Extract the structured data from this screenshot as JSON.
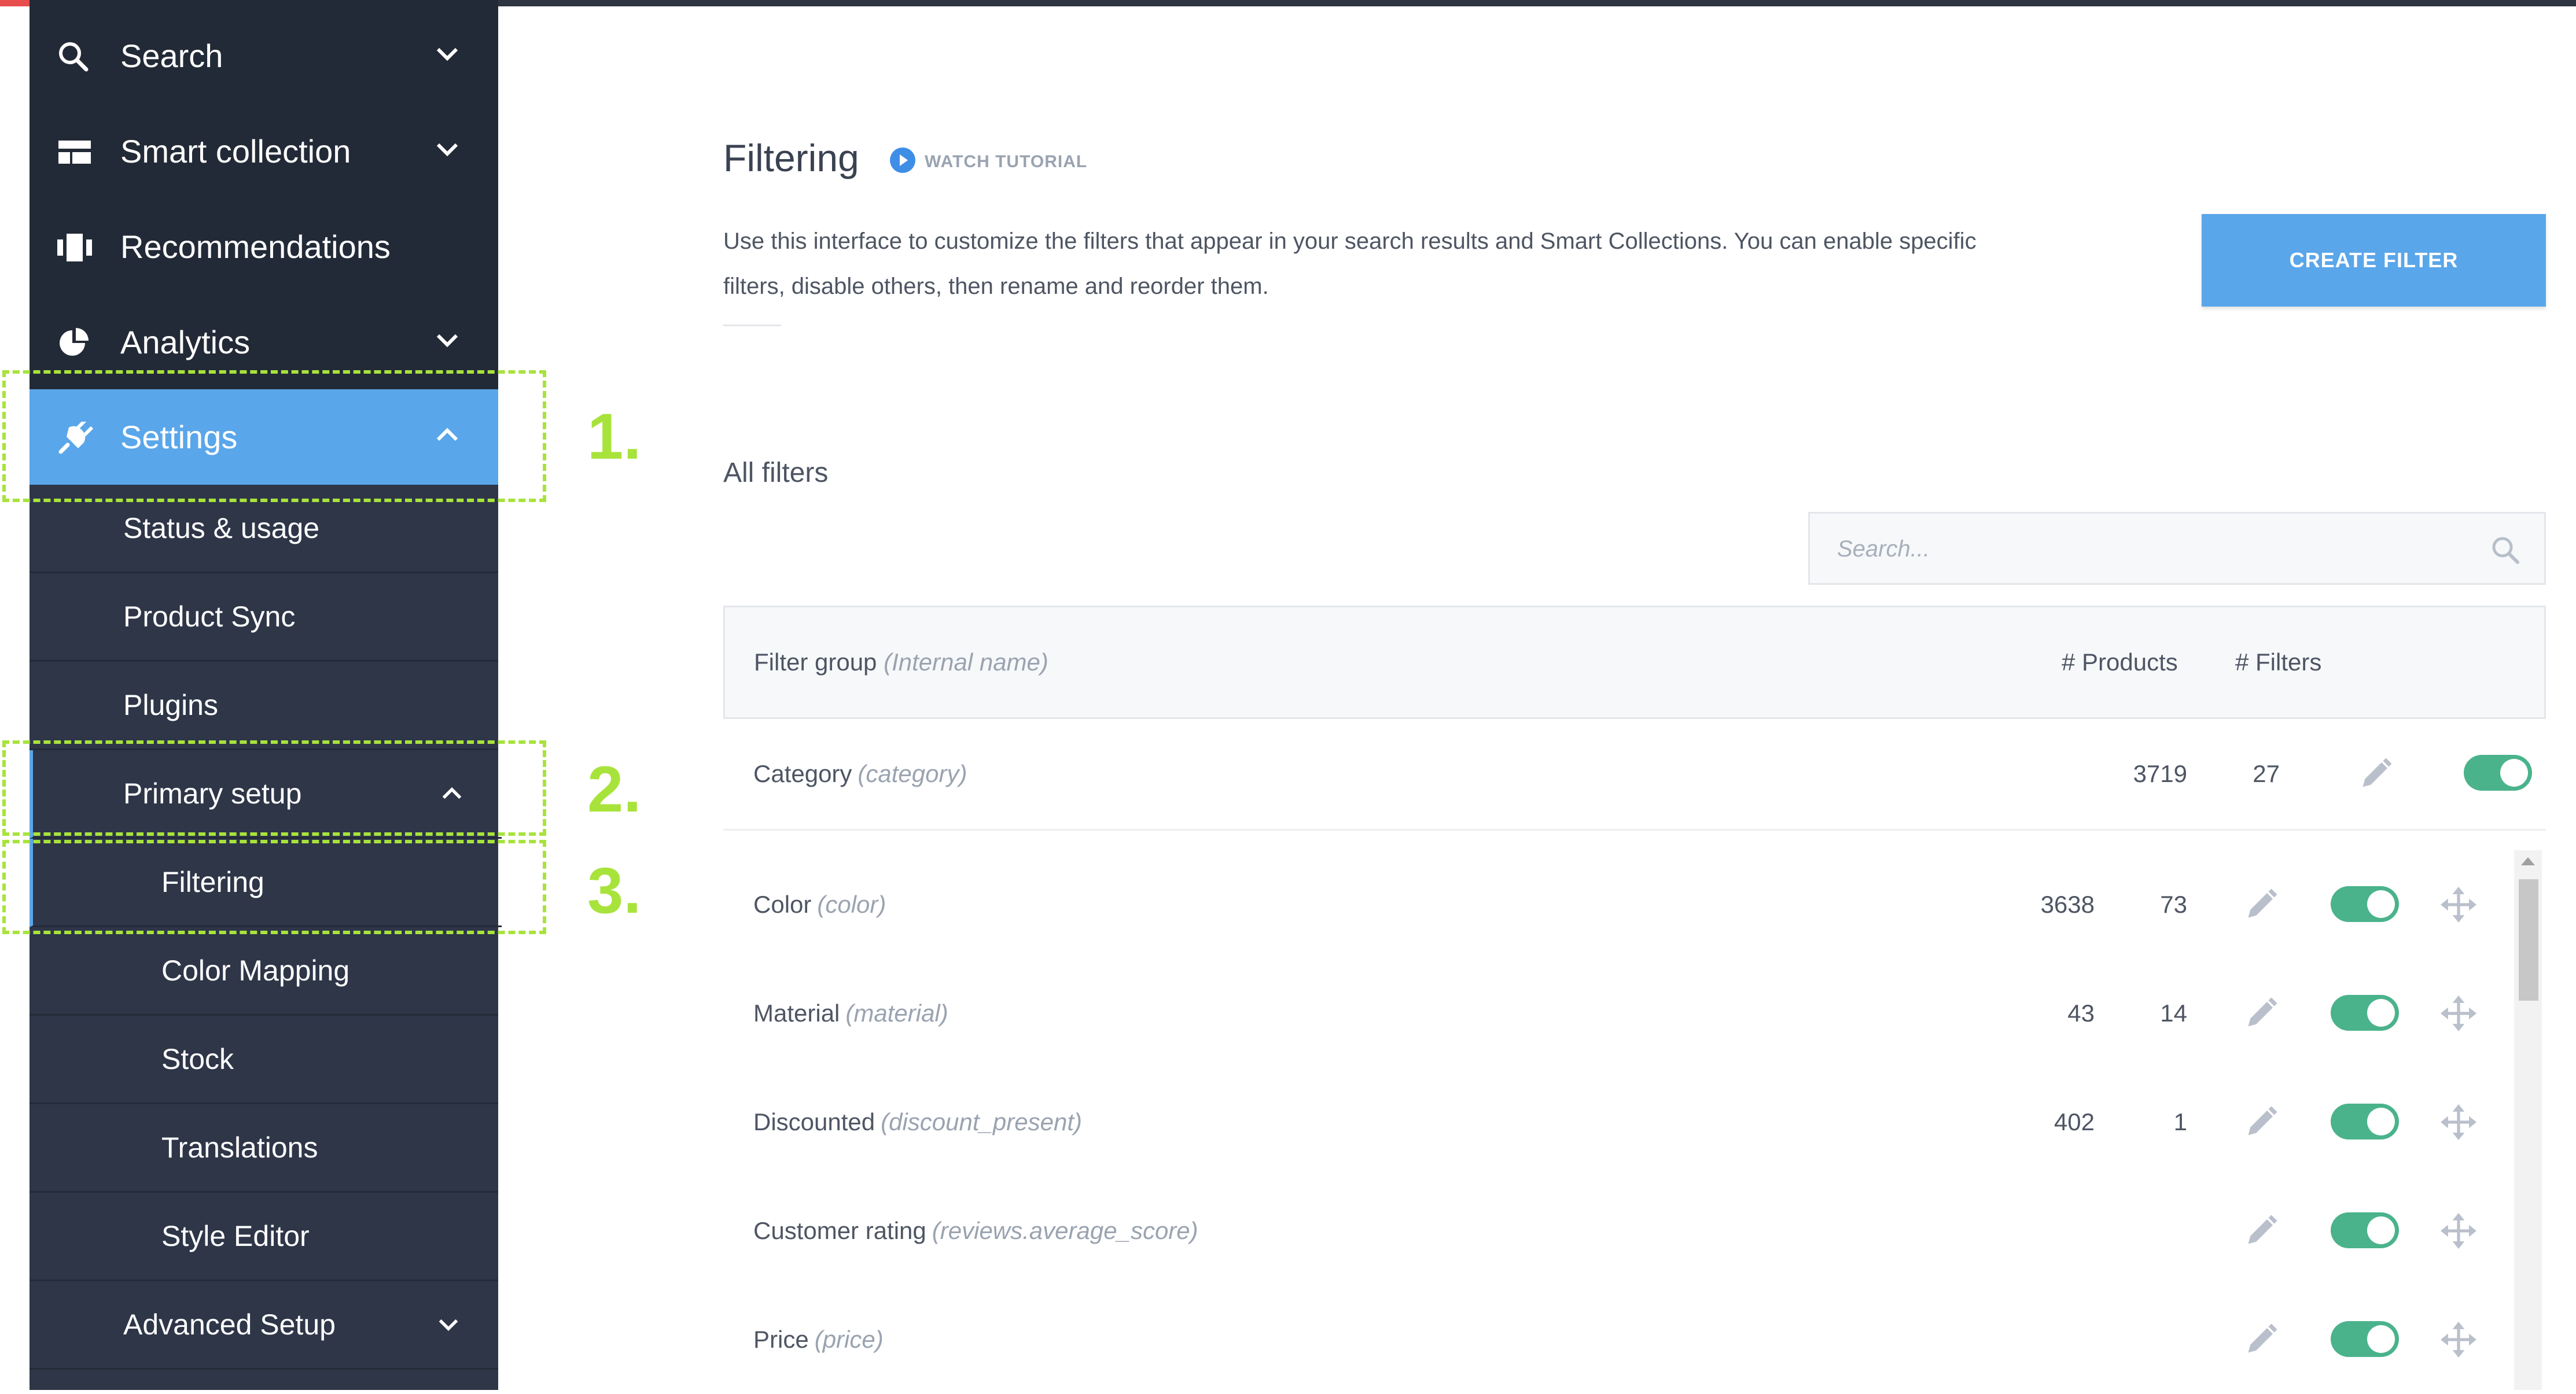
{
  "sidebar": {
    "top_items": [
      {
        "label": "Search",
        "icon": "search-icon",
        "chevron": "down"
      },
      {
        "label": "Smart collection",
        "icon": "collection-icon",
        "chevron": "down"
      },
      {
        "label": "Recommendations",
        "icon": "recommendations-icon",
        "chevron": ""
      },
      {
        "label": "Analytics",
        "icon": "pie-chart-icon",
        "chevron": "down"
      },
      {
        "label": "Settings",
        "icon": "plug-icon",
        "chevron": "up",
        "active": true
      }
    ],
    "sub_items": [
      {
        "label": "Status & usage"
      },
      {
        "label": "Product Sync"
      },
      {
        "label": "Plugins"
      },
      {
        "label": "Primary setup",
        "chevron": "up"
      },
      {
        "label": "Filtering",
        "selected": true
      },
      {
        "label": "Color Mapping"
      },
      {
        "label": "Stock"
      },
      {
        "label": "Translations"
      },
      {
        "label": "Style Editor"
      },
      {
        "label": "Advanced Setup",
        "chevron": "down"
      }
    ]
  },
  "annotations": {
    "step1": "1.",
    "step2": "2.",
    "step3": "3.",
    "color": "#a8e33c"
  },
  "main": {
    "title": "Filtering",
    "watch_tutorial": "WATCH TUTORIAL",
    "intro": "Use this interface to customize the filters that appear in your search results and Smart Collections. You can enable specific filters, disable others, then rename and reorder them.",
    "create_button": "CREATE FILTER",
    "section_title": "All filters",
    "search_placeholder": "Search...",
    "table": {
      "header": {
        "group": "Filter group",
        "internal": "(Internal name)",
        "products": "# Products",
        "filters": "# Filters"
      },
      "pinned_row": {
        "name": "Category",
        "internal": "(category)",
        "products": "3719",
        "filters": "27",
        "enabled": true
      },
      "rows": [
        {
          "name": "Color",
          "internal": "(color)",
          "products": "3638",
          "filters": "73",
          "enabled": true
        },
        {
          "name": "Material",
          "internal": "(material)",
          "products": "43",
          "filters": "14",
          "enabled": true
        },
        {
          "name": "Discounted",
          "internal": "(discount_present)",
          "products": "402",
          "filters": "1",
          "enabled": true
        },
        {
          "name": "Customer rating",
          "internal": "(reviews.average_score)",
          "products": "",
          "filters": "",
          "enabled": true
        },
        {
          "name": "Price",
          "internal": "(price)",
          "products": "",
          "filters": "",
          "enabled": true
        }
      ]
    }
  },
  "colors": {
    "sidebar_dark": "#232a37",
    "sidebar": "#2e3648",
    "accent_blue": "#5aa6ea",
    "toggle_on": "#4ab38c"
  }
}
